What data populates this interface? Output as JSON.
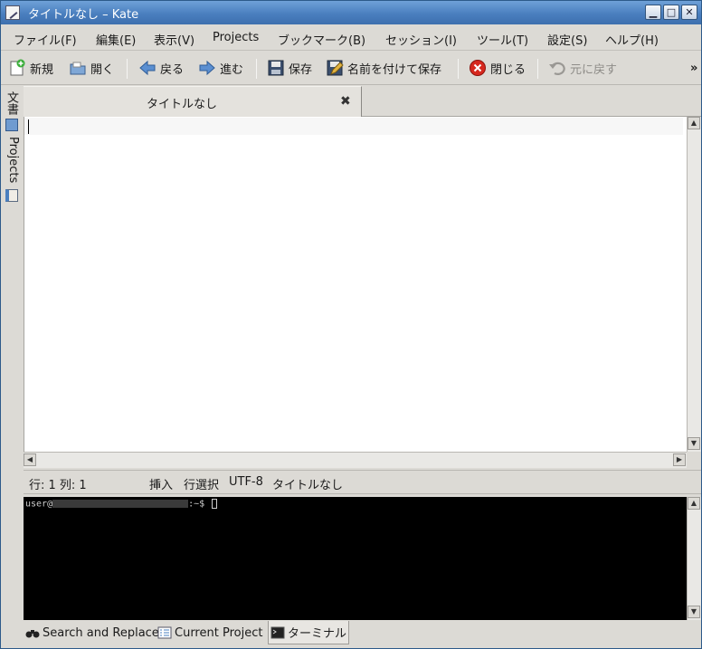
{
  "window": {
    "title": "タイトルなし – Kate"
  },
  "window_controls": {
    "minimize": "▁",
    "maximize": "□",
    "close": "✕"
  },
  "menu": [
    {
      "label": "ファイル(F)"
    },
    {
      "label": "編集(E)"
    },
    {
      "label": "表示(V)"
    },
    {
      "label": "Projects"
    },
    {
      "label": "ブックマーク(B)"
    },
    {
      "label": "セッション(I)"
    },
    {
      "label": "ツール(T)"
    },
    {
      "label": "設定(S)"
    },
    {
      "label": "ヘルプ(H)"
    }
  ],
  "toolbar": {
    "new": "新規",
    "open": "開く",
    "back": "戻る",
    "forward": "進む",
    "save": "保存",
    "save_as": "名前を付けて保存",
    "close": "閉じる",
    "undo": "元に戻す",
    "overflow": "»"
  },
  "side_tabs": {
    "documents": "文書",
    "projects": "Projects"
  },
  "document_tab": {
    "title": "タイトルなし",
    "close": "✖"
  },
  "statusbar": {
    "position": "行: 1 列: 1",
    "mode": "挿入",
    "selection": "行選択",
    "encoding": "UTF-8",
    "filename": "タイトルなし"
  },
  "terminal": {
    "prompt_user": "user@",
    "prompt_suffix": ":~$ "
  },
  "bottom_tabs": {
    "search": "Search and Replace",
    "project": "Current Project",
    "terminal": "ターミナル"
  },
  "colors": {
    "titlebar": "#4a7fbf",
    "chrome": "#dcdad5",
    "editor_bg": "#ffffff",
    "terminal_bg": "#000000",
    "close_icon_red": "#d6281e"
  }
}
